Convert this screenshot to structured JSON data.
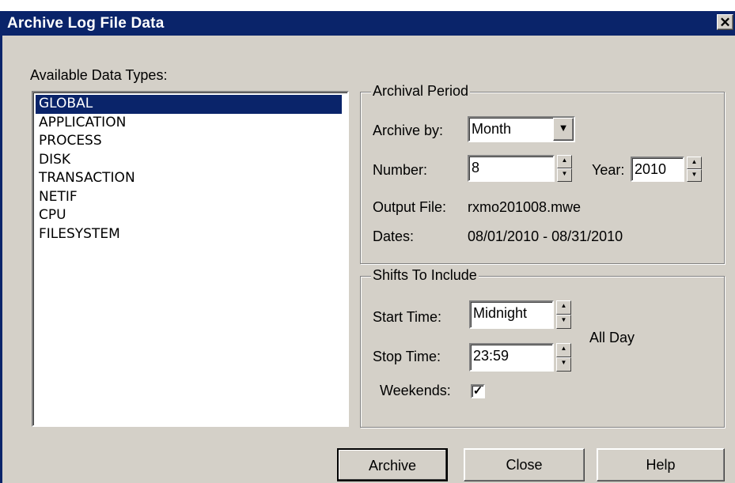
{
  "window": {
    "title": "Archive Log File Data",
    "close_glyph": "✕"
  },
  "data_types": {
    "label": "Available Data Types:",
    "items": [
      "GLOBAL",
      "APPLICATION",
      "PROCESS",
      "DISK",
      "TRANSACTION",
      "NETIF",
      "CPU",
      "FILESYSTEM"
    ],
    "selected": "GLOBAL"
  },
  "archival_period": {
    "legend": "Archival Period",
    "archive_by_label": "Archive by:",
    "archive_by_value": "Month",
    "number_label": "Number:",
    "number_value": "8",
    "year_label": "Year:",
    "year_value": "2010",
    "output_file_label": "Output File:",
    "output_file_value": "rxmo201008.mwe",
    "dates_label": "Dates:",
    "dates_value": "08/01/2010 - 08/31/2010"
  },
  "shifts": {
    "legend": "Shifts To Include",
    "start_time_label": "Start Time:",
    "start_time_value": "Midnight",
    "stop_time_label": "Stop Time:",
    "stop_time_value": "23:59",
    "all_day_text": "All Day",
    "weekends_label": "Weekends:",
    "weekends_checked": true,
    "check_glyph": "✓"
  },
  "buttons": {
    "archive": "Archive",
    "close": "Close",
    "help": "Help"
  },
  "colors": {
    "title_bar": "#0a246a",
    "dialog_face": "#d4d0c8",
    "selection": "#0a246a"
  },
  "icons": {
    "spin_up": "▲",
    "spin_down": "▼",
    "dropdown": "▼"
  }
}
